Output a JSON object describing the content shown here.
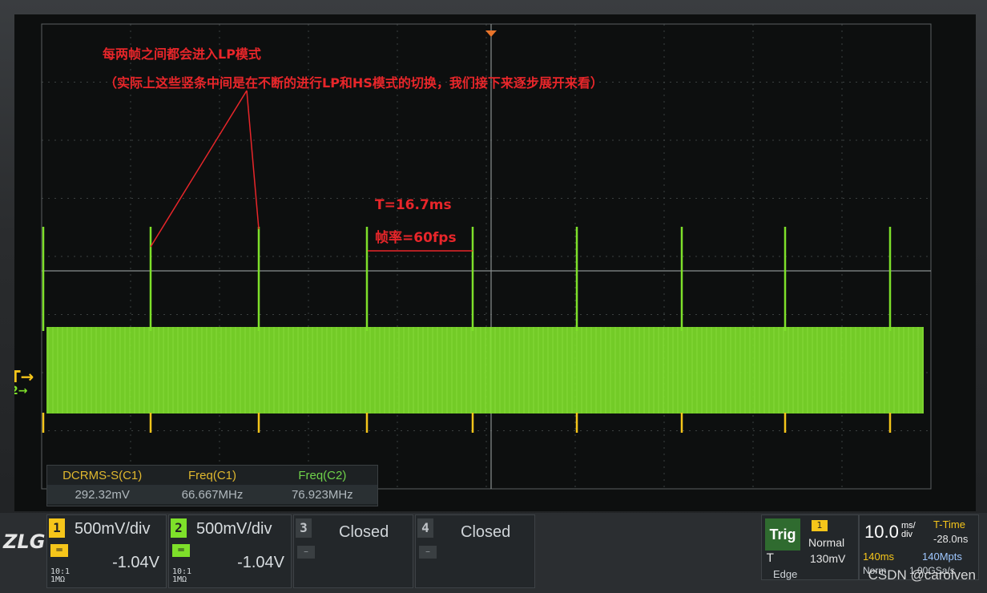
{
  "annotations": {
    "title": "每两帧之间都会进入LP模式",
    "subtitle": "（实际上这些竖条中间是在不断的进行LP和HS模式的切换，我们接下来逐步展开来看）",
    "period": "T=16.7ms",
    "frame_rate": "帧率=60fps"
  },
  "markers": {
    "trigger": "T→",
    "ch2": "2→"
  },
  "measurements": {
    "headers": [
      "DCRMS-S(C1)",
      "Freq(C1)",
      "Freq(C2)"
    ],
    "values": [
      "292.32mV",
      "66.667MHz",
      "76.923MHz"
    ]
  },
  "channels": [
    {
      "num": "1",
      "scale": "500mV/div",
      "offset": "-1.04V",
      "impedance_top": "10:1",
      "impedance_bot": "1MΩ",
      "color": "#f5c51a"
    },
    {
      "num": "2",
      "scale": "500mV/div",
      "offset": "-1.04V",
      "impedance_top": "10:1",
      "impedance_bot": "1MΩ",
      "color": "#7ee02a"
    },
    {
      "num": "3",
      "status": "Closed",
      "color": "#c0c4c8"
    },
    {
      "num": "4",
      "status": "Closed",
      "color": "#c0c4c8"
    }
  ],
  "trigger": {
    "button": "Trig",
    "source": "1",
    "mode": "Normal",
    "t_label": "T",
    "level": "130mV",
    "type": "Edge"
  },
  "timebase": {
    "value": "10.0",
    "unit_top": "ms/",
    "unit_bot": "div",
    "ttime_label": "T-Time",
    "ttime_value": "-28.0ns",
    "memory_depth": "140ms",
    "points": "140Mpts",
    "acq_mode": "Norm",
    "sample_rate": "1.00GSa/s"
  },
  "waveform": {
    "signal_color": "#7ee02a",
    "spike_color": "#f5c51a",
    "spike_count": 9
  },
  "logo": "ZLG",
  "watermark": "CSDN @carolven"
}
